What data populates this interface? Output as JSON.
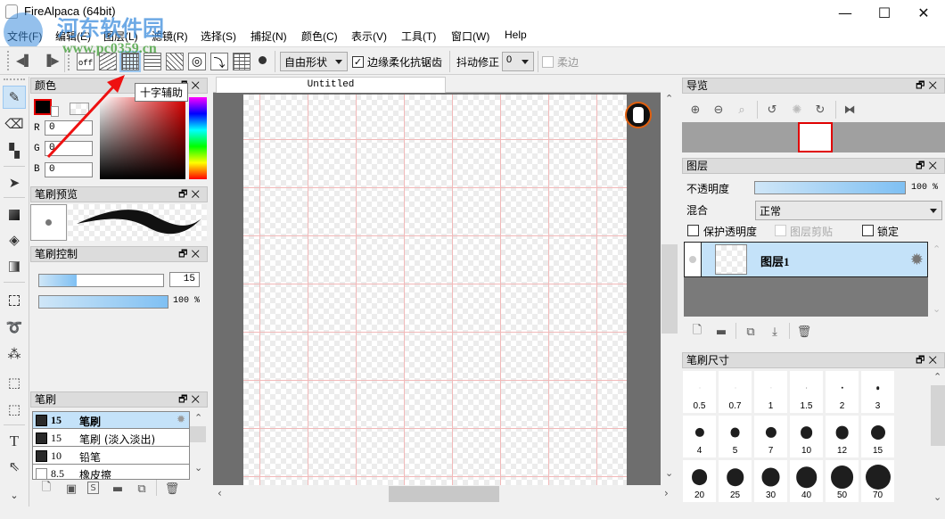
{
  "window": {
    "title": "FireAlpaca (64bit)",
    "minimize": "—",
    "maximize": "☐",
    "close": "✕"
  },
  "menu": [
    "文件(F)",
    "编辑(E)",
    "图层(L)",
    "滤镜(R)",
    "选择(S)",
    "捕捉(N)",
    "颜色(C)",
    "表示(V)",
    "工具(T)",
    "窗口(W)",
    "Help"
  ],
  "watermark": {
    "site_name": "河东软件园",
    "url": "www.pc0359.cn"
  },
  "toolbar": {
    "snap_off_label": "off",
    "snap_tooltip": "十字辅助",
    "shape_select": "自由形状",
    "antialias_label": "边缘柔化抗锯齿",
    "antialias_checked": true,
    "stabilizer_label": "抖动修正",
    "stabilizer_value": "0",
    "soft_edge_label": "柔边",
    "soft_edge_checked": false
  },
  "color_panel": {
    "title": "颜色",
    "r_label": "R",
    "g_label": "G",
    "b_label": "B",
    "r": "0",
    "g": "0",
    "b": "0",
    "primary_color": "#000000"
  },
  "brush_preview": {
    "title": "笔刷预览"
  },
  "brush_control": {
    "title": "笔刷控制",
    "size": "15",
    "opacity": "100 %",
    "size_fraction": 0.3,
    "opacity_fraction": 1.0
  },
  "brush_panel": {
    "title": "笔刷",
    "items": [
      {
        "size": "15",
        "name": "笔刷",
        "selected": true
      },
      {
        "size": "15",
        "name": "笔刷 (淡入淡出)",
        "selected": false
      },
      {
        "size": "10",
        "name": "铅笔",
        "selected": false
      },
      {
        "size": "8.5",
        "name": "橡皮擦",
        "selected": false
      }
    ]
  },
  "document": {
    "tab_label": "Untitled"
  },
  "navigator": {
    "title": "导览"
  },
  "layers": {
    "title": "图层",
    "opacity_label": "不透明度",
    "opacity_value": "100 %",
    "opacity_fraction": 1.0,
    "blend_label": "混合",
    "blend_value": "正常",
    "protect_alpha_label": "保护透明度",
    "clipping_label": "图层剪贴",
    "lock_label": "锁定",
    "items": [
      {
        "name": "图层1"
      }
    ]
  },
  "brush_size": {
    "title": "笔刷尺寸",
    "sizes": [
      "0.5",
      "0.7",
      "1",
      "1.5",
      "2",
      "3",
      "4",
      "5",
      "7",
      "10",
      "12",
      "15",
      "20",
      "25",
      "30",
      "40",
      "50",
      "70"
    ]
  },
  "panel_buttons": {
    "float": "🗗",
    "close": "✕"
  }
}
